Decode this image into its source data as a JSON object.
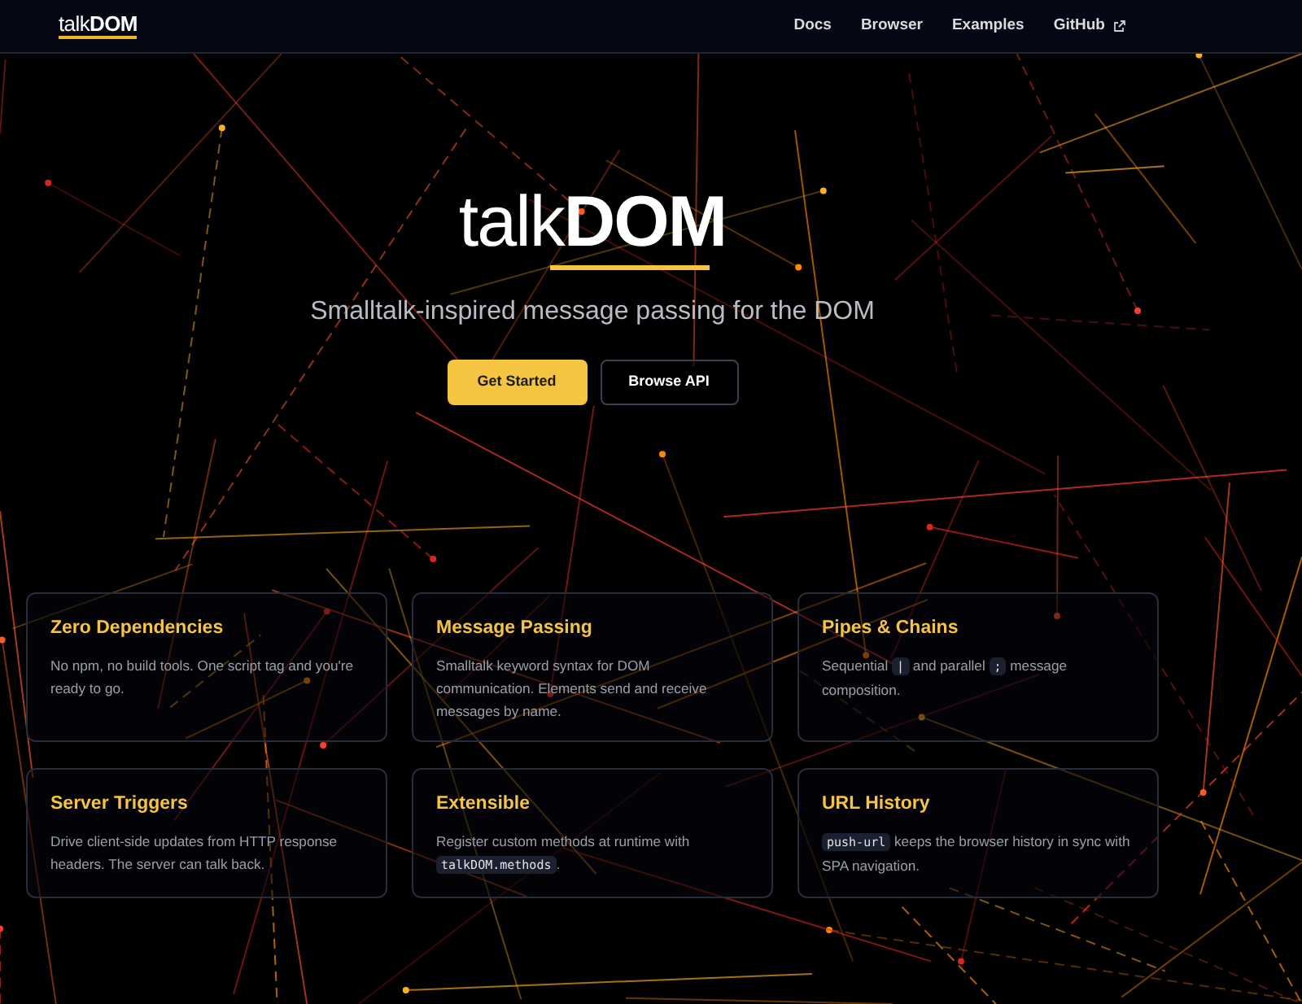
{
  "navbar": {
    "logo": "talk**DOM**",
    "links": [
      {
        "label": "Docs",
        "external": false
      },
      {
        "label": "Browser",
        "external": false
      },
      {
        "label": "Examples",
        "external": false
      },
      {
        "label": "GitHub",
        "external": true
      }
    ]
  },
  "hero": {
    "title": "talk**DOM**",
    "subtitle": "Smalltalk-inspired message passing for the DOM",
    "buttons": [
      {
        "label": "Get Started",
        "kind": "primary"
      },
      {
        "label": "Browse API",
        "kind": "outline"
      }
    ]
  },
  "features": [
    {
      "title": "Zero Dependencies",
      "description": [
        {
          "kind": "text",
          "text": "No npm, no build tools. One script tag and you're ready to go."
        }
      ]
    },
    {
      "title": "Message Passing",
      "description": [
        {
          "kind": "text",
          "text": "Smalltalk keyword syntax for DOM communication. Elements send and receive messages by name."
        }
      ]
    },
    {
      "title": "Pipes & Chains",
      "description": [
        {
          "kind": "text",
          "text": "Sequential "
        },
        {
          "kind": "code",
          "text": "|"
        },
        {
          "kind": "text",
          "text": " and parallel "
        },
        {
          "kind": "code",
          "text": ";"
        },
        {
          "kind": "text",
          "text": " message composition."
        }
      ]
    },
    {
      "title": "Server Triggers",
      "description": [
        {
          "kind": "text",
          "text": "Drive client-side updates from HTTP response headers. The server can talk back."
        }
      ]
    },
    {
      "title": "Extensible",
      "description": [
        {
          "kind": "text",
          "text": "Register custom methods at runtime with "
        },
        {
          "kind": "code",
          "text": "talkDOM.methods"
        },
        {
          "kind": "text",
          "text": "."
        }
      ]
    },
    {
      "title": "URL History",
      "description": [
        {
          "kind": "code",
          "text": "push-url"
        },
        {
          "kind": "text",
          "text": " keeps the browser history in sync with SPA navigation."
        }
      ]
    }
  ]
}
